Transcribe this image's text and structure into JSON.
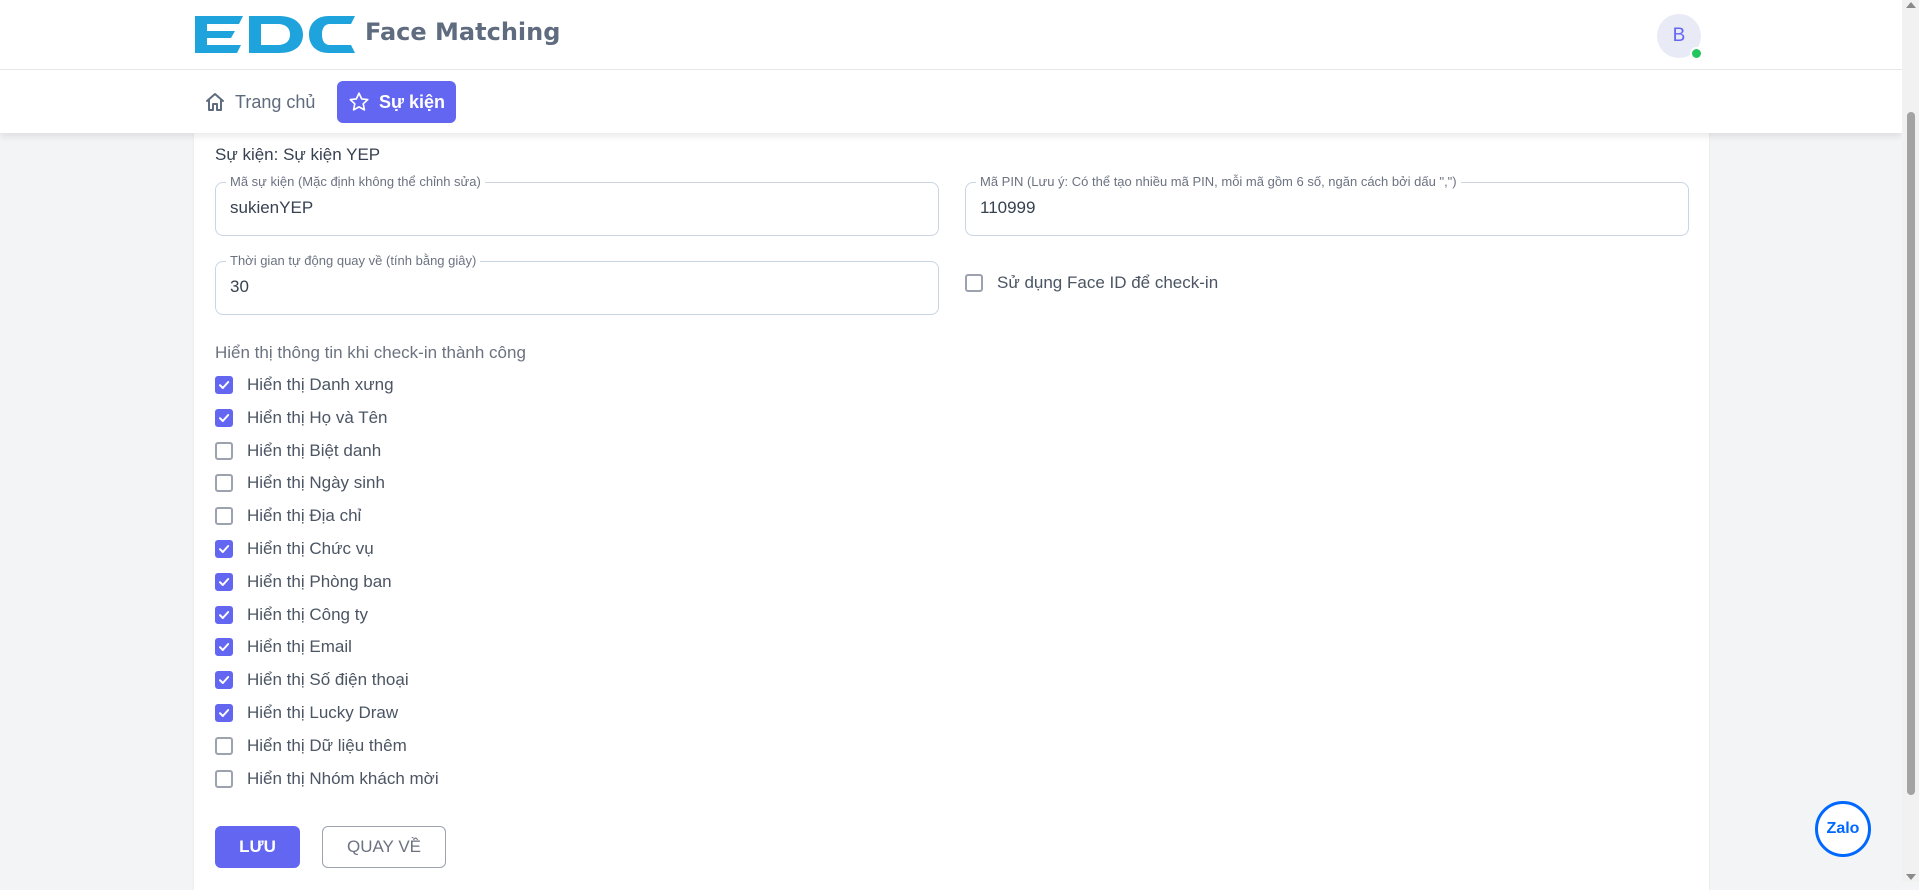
{
  "header": {
    "logo_text": "EDC",
    "app_title": "Face Matching",
    "avatar_initial": "B"
  },
  "nav": {
    "home_label": "Trang chủ",
    "events_label": "Sự kiện"
  },
  "form": {
    "heading": "Sự kiện: Sự kiện YEP",
    "event_code": {
      "label": "Mã sự kiện (Mặc định không thể chỉnh sửa)",
      "value": "sukienYEP"
    },
    "pin": {
      "label": "Mã PIN (Lưu ý: Có thể tạo nhiều mã PIN, mỗi mã gồm 6 số, ngăn cách bởi dấu \",\")",
      "value": "110999"
    },
    "timeout": {
      "label": "Thời gian tự động quay về (tính bằng giây)",
      "value": "30"
    },
    "face_id": {
      "label": "Sử dụng Face ID để check-in",
      "checked": false
    },
    "display_section_title": "Hiển thị thông tin khi check-in thành công",
    "display_options": [
      {
        "label": "Hiển thị Danh xưng",
        "checked": true
      },
      {
        "label": "Hiển thị Họ và Tên",
        "checked": true
      },
      {
        "label": "Hiển thị Biệt danh",
        "checked": false
      },
      {
        "label": "Hiển thị Ngày sinh",
        "checked": false
      },
      {
        "label": "Hiển thị Địa chỉ",
        "checked": false
      },
      {
        "label": "Hiển thị Chức vụ",
        "checked": true
      },
      {
        "label": "Hiển thị Phòng ban",
        "checked": true
      },
      {
        "label": "Hiển thị Công ty",
        "checked": true
      },
      {
        "label": "Hiển thị Email",
        "checked": true
      },
      {
        "label": "Hiển thị Số điện thoại",
        "checked": true
      },
      {
        "label": "Hiển thị Lucky Draw",
        "checked": true
      },
      {
        "label": "Hiển thị Dữ liệu thêm",
        "checked": false
      },
      {
        "label": "Hiển thị Nhóm khách mời",
        "checked": false
      }
    ],
    "save_label": "LƯU",
    "back_label": "QUAY VỀ"
  },
  "widgets": {
    "zalo_label": "Zalo"
  },
  "colors": {
    "accent": "#6366f1",
    "brand_logo": "#1fa3dc",
    "zalo": "#0068ff"
  }
}
